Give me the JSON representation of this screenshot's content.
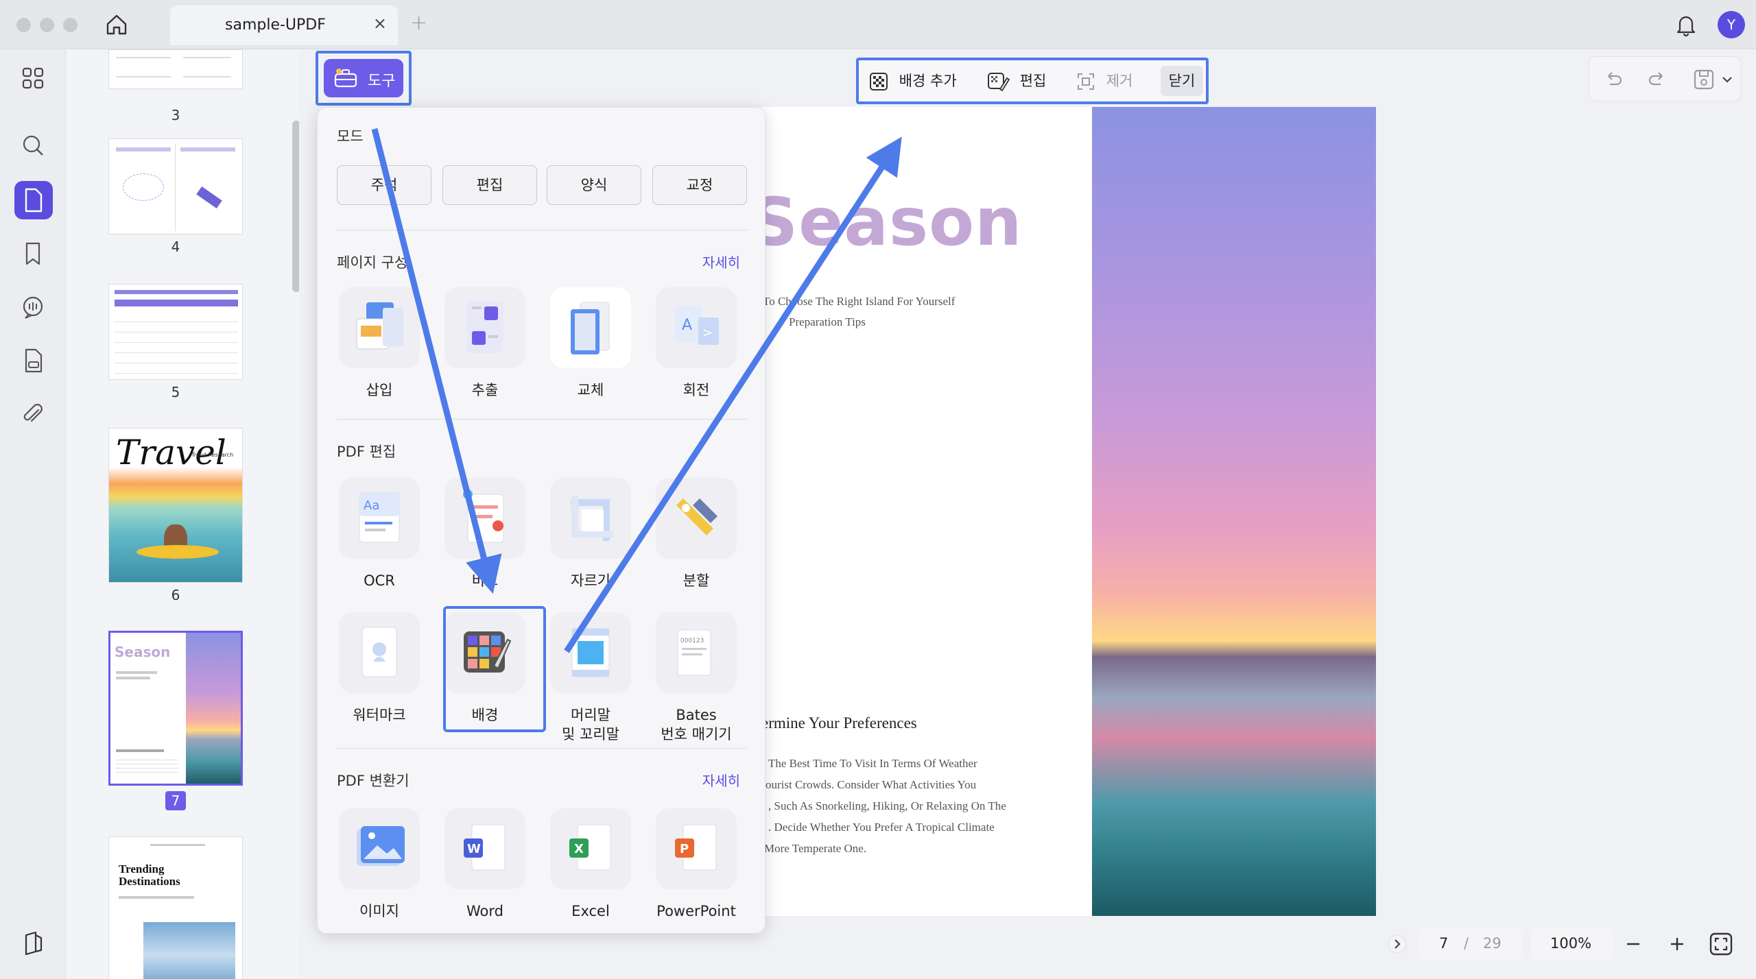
{
  "titlebar": {
    "tab_title": "sample-UPDF",
    "tab_close": "×",
    "new_tab": "+",
    "avatar_initial": "Y"
  },
  "thumbnails": [
    {
      "num": "3"
    },
    {
      "num": "4"
    },
    {
      "num": "5"
    },
    {
      "num": "6"
    },
    {
      "num": "7"
    }
  ],
  "thumb_texts": {
    "travel": "Travel",
    "trend_research": "Trend Research",
    "season": "Season",
    "trending": "Trending Destinations"
  },
  "toolbar": {
    "tool_label": "도구"
  },
  "bg_toolbar": {
    "add": "배경 추가",
    "edit": "편집",
    "remove": "제거",
    "close": "닫기"
  },
  "tools_panel": {
    "mode_title": "모드",
    "modes": [
      "주석",
      "편집",
      "양식",
      "교정"
    ],
    "page_section": "페이지 구성",
    "page_more": "자세히",
    "page_tools": [
      "삽입",
      "추출",
      "교체",
      "회전"
    ],
    "edit_section": "PDF 편집",
    "edit_tools_row1": [
      "OCR",
      "비교",
      "자르기",
      "분할"
    ],
    "edit_tools_row2": [
      "워터마크",
      "배경",
      "머리말\n및 꼬리말",
      "Bates\n번호 매기기"
    ],
    "convert_section": "PDF 변환기",
    "convert_more": "자세히",
    "convert_tools": [
      "이미지",
      "Word",
      "Excel",
      "PowerPoint"
    ]
  },
  "document": {
    "title": "Season",
    "line1": "To Choose The Right Island For Yourself",
    "line2": "Preparation Tips",
    "heading": "ermine Your Preferences",
    "para": [
      "The Best Time To Visit In Terms Of Weather",
      "ourist Crowds. Consider What Activities You",
      ", Such As Snorkeling, Hiking, Or Relaxing On The",
      ". Decide Whether You Prefer A Tropical Climate",
      "More Temperate One."
    ]
  },
  "status": {
    "current_page": "7",
    "separator": "/",
    "total_pages": "29",
    "zoom": "100%"
  },
  "colors": {
    "accent": "#5b4ce0",
    "highlight": "#4d7be9"
  }
}
